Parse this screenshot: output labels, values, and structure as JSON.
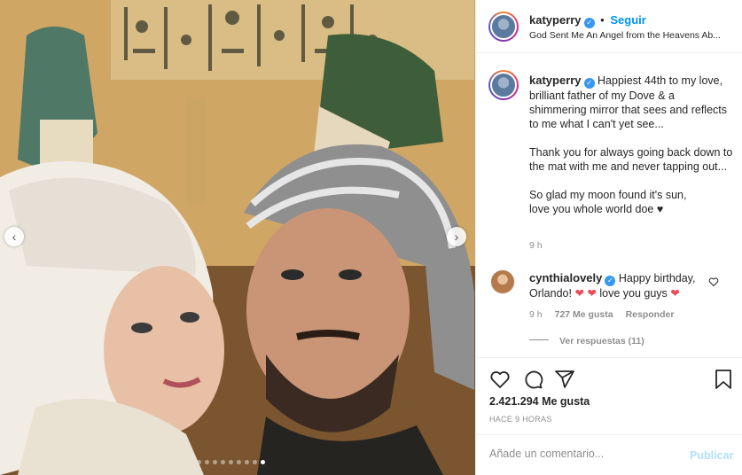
{
  "post": {
    "author": "katyperry",
    "follow_label": "Seguir",
    "separator": "•",
    "subtitle": "God Sent Me An Angel from the Heavens Ab...",
    "carousel": {
      "slides": 9,
      "active_index": 8
    }
  },
  "caption": {
    "author": "katyperry",
    "text_p1": "Happiest 44th to my love, brilliant father of my Dove & a shimmering mirror that sees and reflects to me what I can't yet see...",
    "text_p2": "Thank you for always going back down to the mat with me and never tapping out...",
    "text_p3_line1": "So glad my moon found it's sun,",
    "text_p3_line2": "love you whole world doe ♥",
    "time": "9 h"
  },
  "comment": {
    "author": "cynthialovely",
    "text_a": "Happy birthday, Orlando!",
    "hearts_a": "❤ ❤",
    "text_b": "love you guys",
    "heart_b": "❤",
    "time": "9 h",
    "likes": "727 Me gusta",
    "reply_label": "Responder",
    "view_replies": "Ver respuestas (11)"
  },
  "actions": {
    "likes_count": "2.421.294 Me gusta",
    "timestamp": "HACE 9 HORAS"
  },
  "add_comment": {
    "placeholder": "Añade un comentario...",
    "publish_label": "Publicar"
  },
  "colors": {
    "accent": "#0095f6",
    "verified": "#3897f0",
    "publish_disabled": "#b2dffc",
    "heart": "#ed4956"
  },
  "icons": [
    "chevron-left-icon",
    "chevron-right-icon",
    "verified-icon",
    "heart-icon",
    "comment-icon",
    "share-icon",
    "bookmark-icon"
  ]
}
